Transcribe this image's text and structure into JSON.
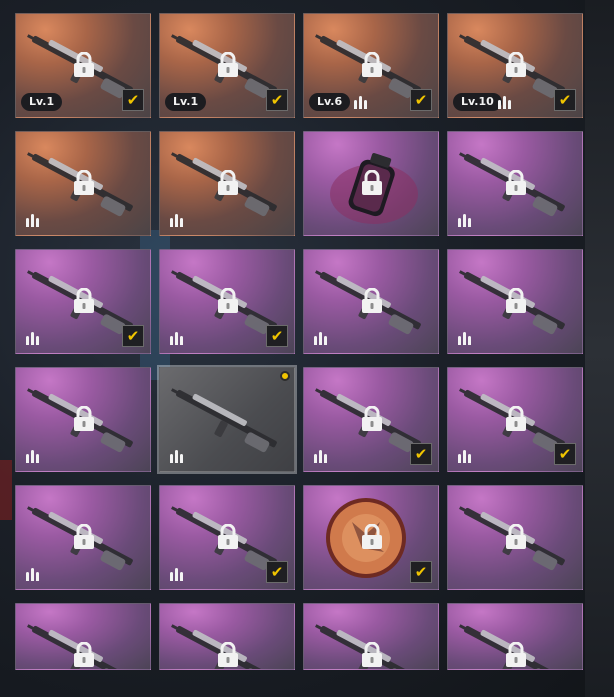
{
  "colors": {
    "checkmark": "#f0c400",
    "tile_orange": "#b06a4a",
    "tile_purple": "#9a5aa2",
    "notif_dot": "#f0c400"
  },
  "rows": [
    [
      {
        "name": "rifle-1",
        "bg": "orange",
        "lock": true,
        "check": true,
        "level": "Lv.1",
        "bullets": false,
        "art": "rifle"
      },
      {
        "name": "rifle-2",
        "bg": "orange",
        "lock": true,
        "check": true,
        "level": "Lv.1",
        "bullets": false,
        "art": "rifle"
      },
      {
        "name": "rifle-3",
        "bg": "orange",
        "lock": true,
        "check": true,
        "level": "Lv.6",
        "bullets": true,
        "art": "rifle"
      },
      {
        "name": "rifle-4",
        "bg": "orange",
        "lock": true,
        "check": true,
        "level": "Lv.10",
        "bullets": true,
        "art": "rifle"
      }
    ],
    [
      {
        "name": "rifle-5",
        "bg": "orange",
        "lock": true,
        "check": false,
        "level": "",
        "bullets": true,
        "art": "rifle"
      },
      {
        "name": "rifle-6",
        "bg": "orange",
        "lock": true,
        "check": false,
        "level": "",
        "bullets": true,
        "art": "rifle"
      },
      {
        "name": "grenade",
        "bg": "purple",
        "lock": true,
        "check": false,
        "level": "",
        "bullets": false,
        "art": "grenade"
      },
      {
        "name": "rifle-7",
        "bg": "purple",
        "lock": true,
        "check": false,
        "level": "",
        "bullets": true,
        "art": "rifle"
      }
    ],
    [
      {
        "name": "rifle-8",
        "bg": "purple",
        "lock": true,
        "check": true,
        "level": "",
        "bullets": true,
        "art": "rifle"
      },
      {
        "name": "rifle-9",
        "bg": "purple",
        "lock": true,
        "check": true,
        "level": "",
        "bullets": true,
        "art": "rifle"
      },
      {
        "name": "rifle-10",
        "bg": "purple",
        "lock": true,
        "check": false,
        "level": "",
        "bullets": true,
        "art": "rifle"
      },
      {
        "name": "rifle-11",
        "bg": "purple",
        "lock": true,
        "check": false,
        "level": "",
        "bullets": true,
        "art": "rifle"
      }
    ],
    [
      {
        "name": "rifle-12",
        "bg": "purple",
        "lock": true,
        "check": false,
        "level": "",
        "bullets": true,
        "art": "rifle"
      },
      {
        "name": "rifle-13",
        "bg": "dark",
        "lock": false,
        "check": false,
        "level": "",
        "bullets": true,
        "art": "rifle",
        "selected": true,
        "notif": true
      },
      {
        "name": "rifle-14",
        "bg": "purple",
        "lock": true,
        "check": true,
        "level": "",
        "bullets": true,
        "art": "rifle"
      },
      {
        "name": "rifle-15",
        "bg": "purple",
        "lock": true,
        "check": true,
        "level": "",
        "bullets": true,
        "art": "rifle"
      }
    ],
    [
      {
        "name": "rifle-16",
        "bg": "purple",
        "lock": true,
        "check": false,
        "level": "",
        "bullets": true,
        "art": "rifle"
      },
      {
        "name": "rifle-17",
        "bg": "purple",
        "lock": true,
        "check": true,
        "level": "",
        "bullets": true,
        "art": "rifle"
      },
      {
        "name": "shield",
        "bg": "purple",
        "lock": true,
        "check": true,
        "level": "",
        "bullets": false,
        "art": "shield"
      },
      {
        "name": "rifle-18",
        "bg": "purple",
        "lock": true,
        "check": false,
        "level": "",
        "bullets": false,
        "art": "rifle"
      }
    ],
    [
      {
        "name": "rifle-19",
        "bg": "purple",
        "lock": true,
        "check": false,
        "level": "",
        "bullets": false,
        "art": "rifle"
      },
      {
        "name": "rifle-20",
        "bg": "purple",
        "lock": true,
        "check": false,
        "level": "",
        "bullets": false,
        "art": "rifle"
      },
      {
        "name": "rifle-21",
        "bg": "purple",
        "lock": true,
        "check": false,
        "level": "",
        "bullets": false,
        "art": "rifle"
      },
      {
        "name": "rifle-22",
        "bg": "purple",
        "lock": true,
        "check": false,
        "level": "",
        "bullets": false,
        "art": "rifle"
      }
    ]
  ]
}
